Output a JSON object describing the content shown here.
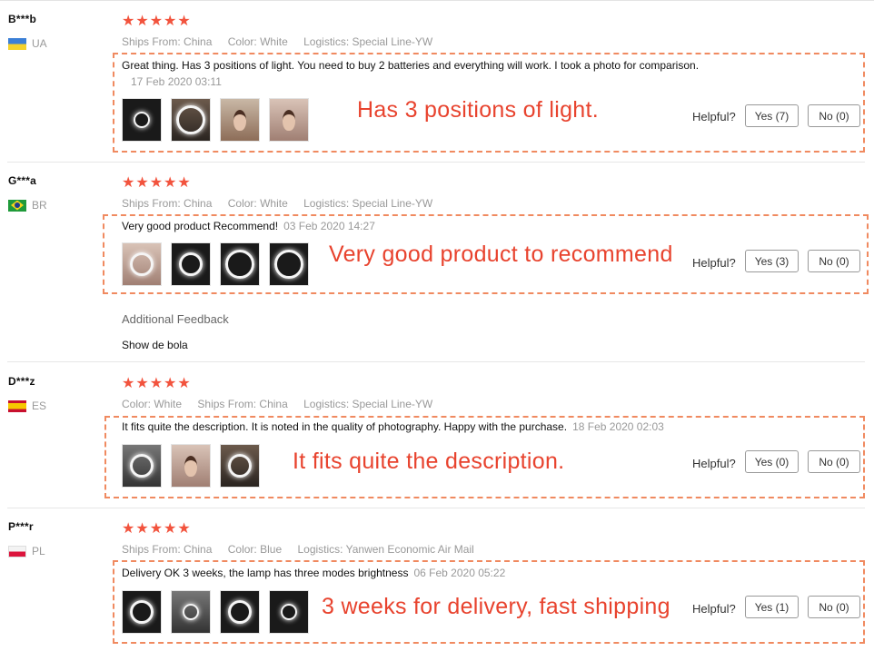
{
  "labels": {
    "ships_from": "Ships From:",
    "color": "Color:",
    "logistics": "Logistics:",
    "helpful": "Helpful?",
    "stars": "★★★★★",
    "additional_feedback": "Additional Feedback"
  },
  "colors": {
    "star": "#f2533d",
    "annotation": "#e8432e",
    "annotation_border": "#f08a60"
  },
  "reviews": [
    {
      "user": "B***b",
      "country": "UA",
      "flag": "flag-ua",
      "ships_from": "China",
      "color": "White",
      "logistics": "Special Line-YW",
      "text": "Great thing. Has 3 positions of light. You need to buy 2 batteries and everything will work. I took a photo for comparison.",
      "date": "17 Feb 2020 03:11",
      "overlay": "Has 3 positions of light.",
      "yes": "Yes (7)",
      "no": "No (0)",
      "rating": 5
    },
    {
      "user": "G***a",
      "country": "BR",
      "flag": "flag-br",
      "ships_from": "China",
      "color": "White",
      "logistics": "Special Line-YW",
      "text": "Very good product Recommend!",
      "date": "03 Feb 2020 14:27",
      "overlay": "Very good product to recommend",
      "yes": "Yes (3)",
      "no": "No (0)",
      "additional_text": "Show de bola",
      "rating": 5
    },
    {
      "user": "D***z",
      "country": "ES",
      "flag": "flag-es",
      "color": "White",
      "ships_from": "China",
      "logistics": "Special Line-YW",
      "text": "It fits quite the description. It is noted in the quality of photography. Happy with the purchase.",
      "date": "18 Feb 2020 02:03",
      "overlay": "It fits quite the description.",
      "yes": "Yes (0)",
      "no": "No (0)",
      "rating": 5
    },
    {
      "user": "P***r",
      "country": "PL",
      "flag": "flag-pl",
      "ships_from": "China",
      "color": "Blue",
      "logistics": "Yanwen Economic Air Mail",
      "text": "Delivery OK 3 weeks, the lamp has three modes brightness",
      "date": "06 Feb 2020 05:22",
      "overlay": "3 weeks for delivery, fast shipping",
      "yes": "Yes (1)",
      "no": "No (0)",
      "rating": 5
    }
  ]
}
